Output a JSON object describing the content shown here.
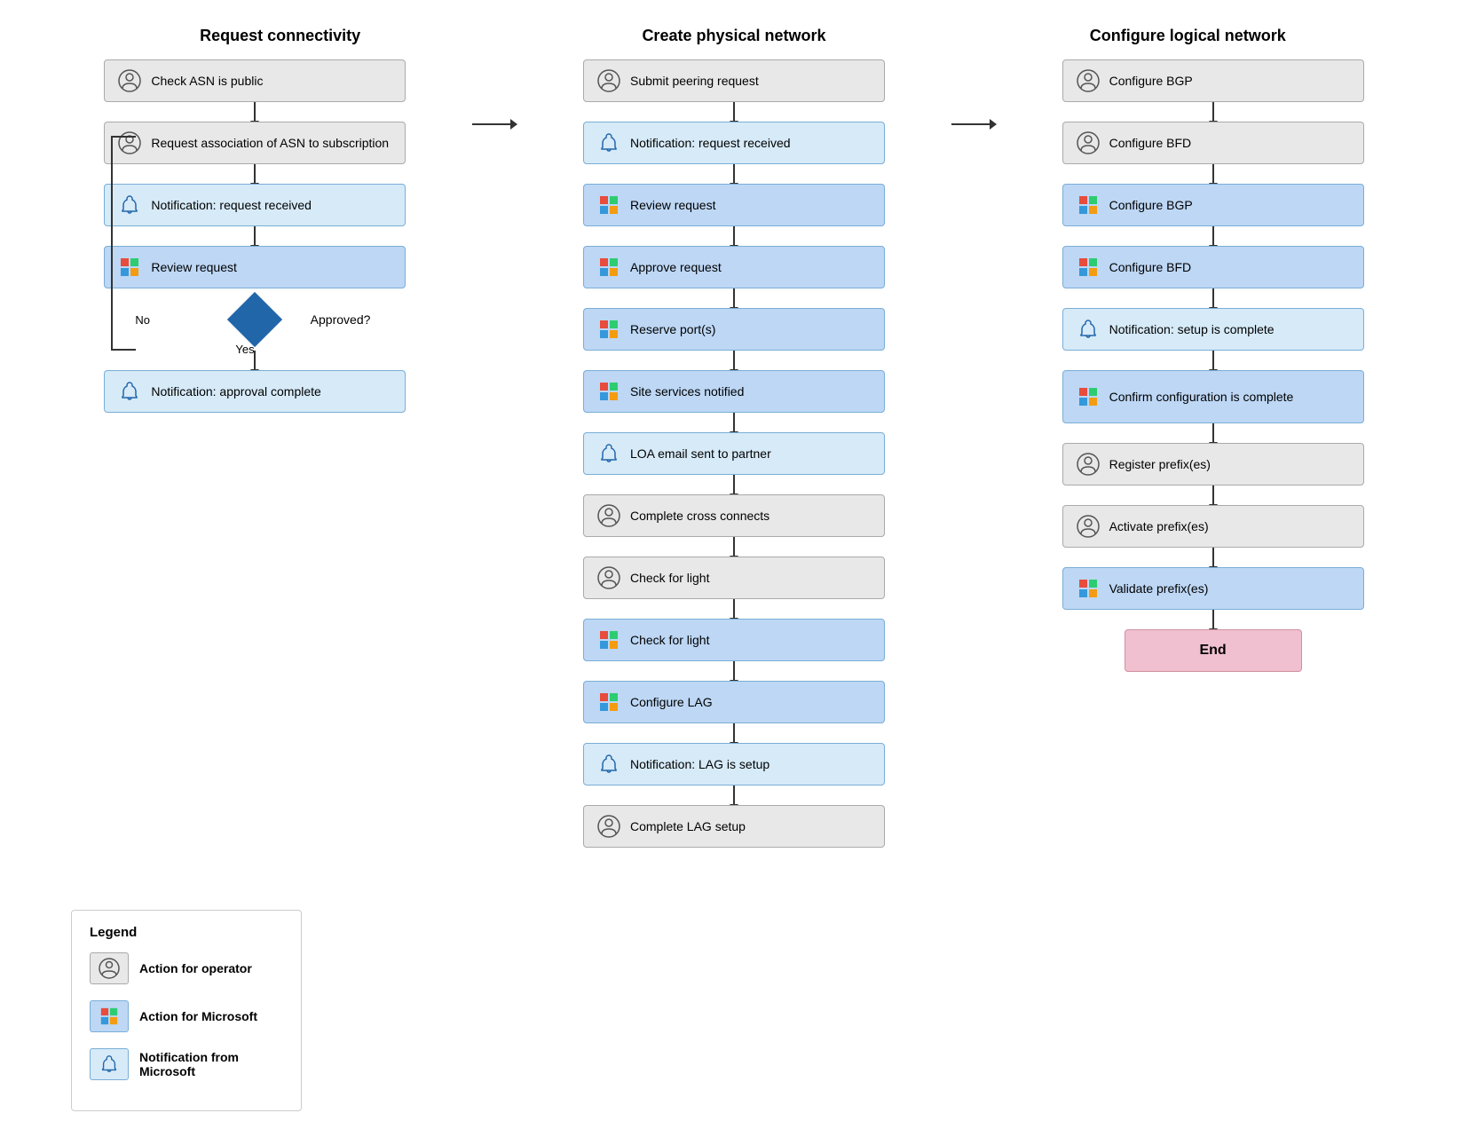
{
  "columns": [
    {
      "title": "Request connectivity",
      "nodes": [
        {
          "type": "operator",
          "text": "Check ASN is public"
        },
        {
          "type": "operator",
          "text": "Request association of ASN to subscription"
        },
        {
          "type": "notification",
          "text": "Notification: request received"
        },
        {
          "type": "microsoft",
          "text": "Review request"
        },
        {
          "type": "diamond",
          "label": "Approved?",
          "no": "No",
          "yes": "Yes"
        },
        {
          "type": "notification",
          "text": "Notification: approval complete"
        }
      ]
    },
    {
      "title": "Create physical network",
      "nodes": [
        {
          "type": "operator",
          "text": "Submit peering request"
        },
        {
          "type": "notification",
          "text": "Notification: request received"
        },
        {
          "type": "microsoft",
          "text": "Review request"
        },
        {
          "type": "microsoft",
          "text": "Approve request"
        },
        {
          "type": "microsoft",
          "text": "Reserve port(s)"
        },
        {
          "type": "microsoft",
          "text": "Site services notified"
        },
        {
          "type": "notification",
          "text": "LOA email sent to partner"
        },
        {
          "type": "operator",
          "text": "Complete cross connects"
        },
        {
          "type": "operator",
          "text": "Check for light"
        },
        {
          "type": "microsoft",
          "text": "Check for light"
        },
        {
          "type": "microsoft",
          "text": "Configure LAG"
        },
        {
          "type": "notification",
          "text": "Notification: LAG is setup"
        },
        {
          "type": "operator",
          "text": "Complete LAG setup"
        }
      ]
    },
    {
      "title": "Configure logical network",
      "nodes": [
        {
          "type": "operator",
          "text": "Configure BGP"
        },
        {
          "type": "operator",
          "text": "Configure BFD"
        },
        {
          "type": "microsoft",
          "text": "Configure BGP"
        },
        {
          "type": "microsoft",
          "text": "Configure BFD"
        },
        {
          "type": "notification",
          "text": "Notification: setup is complete"
        },
        {
          "type": "microsoft",
          "text": "Confirm configuration is complete"
        },
        {
          "type": "operator",
          "text": "Register prefix(es)"
        },
        {
          "type": "operator",
          "text": "Activate prefix(es)"
        },
        {
          "type": "microsoft",
          "text": "Validate prefix(es)"
        },
        {
          "type": "end",
          "text": "End"
        }
      ]
    }
  ],
  "legend": {
    "title": "Legend",
    "items": [
      {
        "type": "operator",
        "label": "Action for operator"
      },
      {
        "type": "microsoft",
        "label": "Action for Microsoft"
      },
      {
        "type": "notification",
        "label": "Notification from Microsoft"
      }
    ]
  }
}
